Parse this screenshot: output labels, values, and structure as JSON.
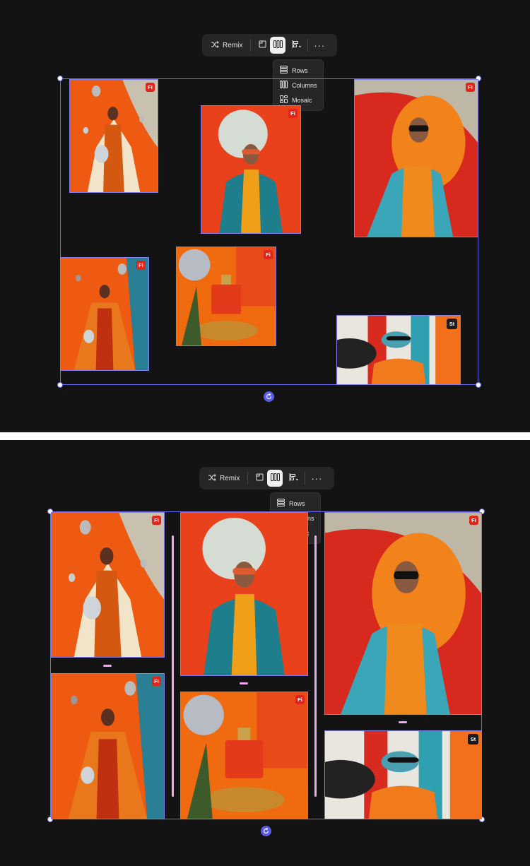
{
  "toolbar": {
    "remix_label": "Remix",
    "icons": [
      "shuffle-icon",
      "frame-icon",
      "columns-icon",
      "align-icon",
      "more-icon"
    ]
  },
  "layout_menu": {
    "items": [
      {
        "label": "Rows",
        "icon": "rows-icon"
      },
      {
        "label": "Columns",
        "icon": "columns-icon"
      },
      {
        "label": "Mosaic",
        "icon": "mosaic-icon"
      }
    ]
  },
  "badges": {
    "firefly": "Fi",
    "stock": "St"
  },
  "colors": {
    "selection": "#6b6cf5",
    "divider": "#f0a8e8",
    "firefly_badge": "#e0251b",
    "canvas": "#131314"
  },
  "photos": [
    {
      "subject": "fashion-mannequin-discoballs",
      "badge": "Fi"
    },
    {
      "subject": "woman-sunglasses-teal-coat",
      "badge": "Fi"
    },
    {
      "subject": "woman-cruise-ship-orange",
      "badge": "Fi"
    },
    {
      "subject": "woman-fringe-jacket-balloons",
      "badge": "Fi"
    },
    {
      "subject": "perfume-bottle-discoball",
      "badge": "Fi"
    },
    {
      "subject": "collage-woman-sunglasses",
      "badge": "St"
    }
  ]
}
